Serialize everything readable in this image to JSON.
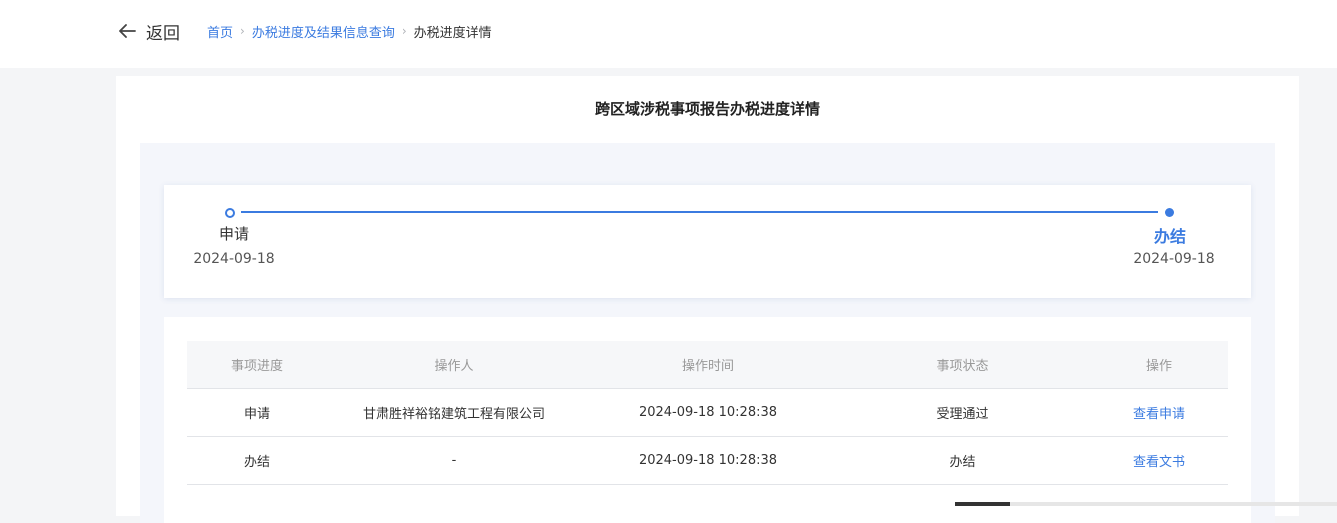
{
  "header": {
    "back_label": "返回",
    "breadcrumb": [
      {
        "label": "首页"
      },
      {
        "label": "办税进度及结果信息查询"
      },
      {
        "label": "办税进度详情"
      }
    ]
  },
  "page": {
    "title": "跨区域涉税事项报告办税进度详情"
  },
  "progress": {
    "steps": [
      {
        "name": "申请",
        "date": "2024-09-18"
      },
      {
        "name": "办结",
        "date": "2024-09-18"
      }
    ]
  },
  "table": {
    "headers": [
      "事项进度",
      "操作人",
      "操作时间",
      "事项状态",
      "操作"
    ],
    "rows": [
      {
        "stage": "申请",
        "operator": "甘肃胜祥裕铭建筑工程有限公司",
        "time": "2024-09-18 10:28:38",
        "status": "受理通过",
        "action": "查看申请"
      },
      {
        "stage": "办结",
        "operator": "-",
        "time": "2024-09-18 10:28:38",
        "status": "办结",
        "action": "查看文书"
      }
    ]
  },
  "colors": {
    "accent": "#3b7be0",
    "page_bg": "#f4f5f7"
  },
  "icons": {
    "back": "arrow-left-icon"
  }
}
